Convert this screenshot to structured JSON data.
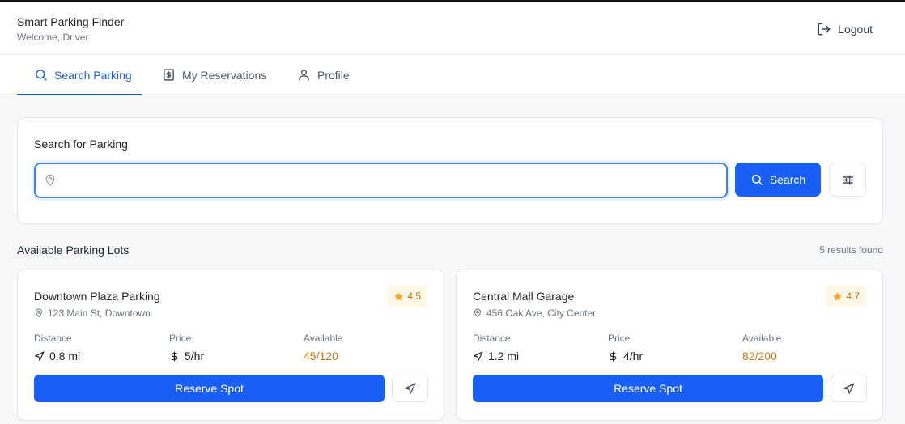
{
  "header": {
    "app_title": "Smart Parking Finder",
    "welcome": "Welcome, Driver",
    "logout_label": "Logout"
  },
  "tabs": [
    {
      "label": "Search Parking",
      "icon": "search-icon",
      "active": true
    },
    {
      "label": "My Reservations",
      "icon": "dollar-receipt-icon",
      "active": false
    },
    {
      "label": "Profile",
      "icon": "user-icon",
      "active": false
    }
  ],
  "search": {
    "heading": "Search for Parking",
    "value": "",
    "button_label": "Search"
  },
  "lots_section": {
    "title": "Available Parking Lots",
    "results": "5 results found"
  },
  "stat_labels": {
    "distance": "Distance",
    "price": "Price",
    "available": "Available"
  },
  "lots": [
    {
      "name": "Downtown Plaza Parking",
      "address": "123 Main St, Downtown",
      "rating": "4.5",
      "distance": "0.8 mi",
      "price": "5/hr",
      "available": "45/120",
      "reserve_label": "Reserve Spot"
    },
    {
      "name": "Central Mall Garage",
      "address": "456 Oak Ave, City Center",
      "rating": "4.7",
      "distance": "1.2 mi",
      "price": "4/hr",
      "available": "82/200",
      "reserve_label": "Reserve Spot"
    }
  ],
  "colors": {
    "primary": "#1a5ff5",
    "tab_active": "#1d5fd6",
    "rating_star": "#f5a623",
    "available_text": "#c07a1a"
  }
}
